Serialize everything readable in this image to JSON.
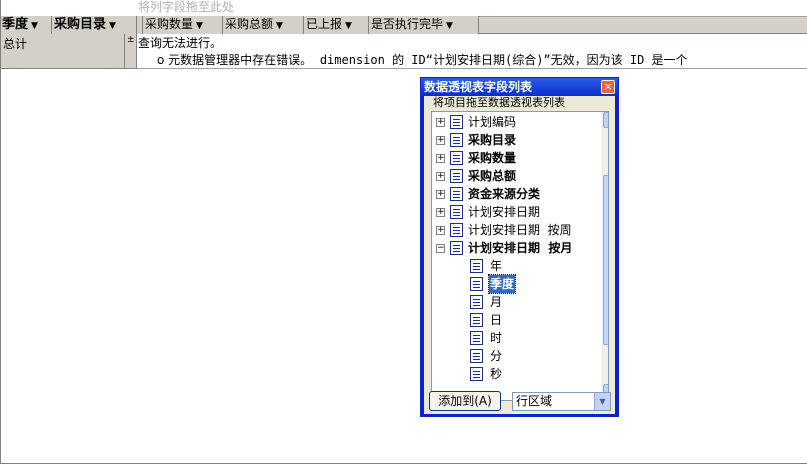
{
  "pivot": {
    "column_drop_hint": "将列字段拖至此处",
    "row_fields": [
      "季度",
      "采购目录"
    ],
    "data_fields": [
      "采购数量",
      "采购总额",
      "已上报",
      "是否执行完毕"
    ],
    "total_label": "总计",
    "expand_glyph": "±",
    "error_title": "查询无法进行。",
    "error_bullet": "o",
    "error_detail_prefix": "元数据管理器中存在错误。",
    "error_detail_rest": "dimension 的 ID“计划安排日期(综合)”无效，因为该 ID 是一个"
  },
  "field_list": {
    "title": "数据透视表字段列表",
    "close_glyph": "×",
    "hint": "将项目拖至数据透视表列表",
    "items": [
      {
        "label": "计划编码",
        "bold": false,
        "expander": "+"
      },
      {
        "label": "采购目录",
        "bold": true,
        "expander": "+"
      },
      {
        "label": "采购数量",
        "bold": true,
        "expander": "+"
      },
      {
        "label": "采购总额",
        "bold": true,
        "expander": "+"
      },
      {
        "label": "资金来源分类",
        "bold": true,
        "expander": "+"
      },
      {
        "label": "计划安排日期",
        "bold": false,
        "expander": "+"
      },
      {
        "label": "计划安排日期  按周",
        "bold": false,
        "expander": "+"
      },
      {
        "label": "计划安排日期  按月",
        "bold": true,
        "expander": "−"
      }
    ],
    "subitems": [
      {
        "label": "年",
        "selected": false
      },
      {
        "label": "季度",
        "selected": true
      },
      {
        "label": "月",
        "selected": false
      },
      {
        "label": "日",
        "selected": false
      },
      {
        "label": "时",
        "selected": false
      },
      {
        "label": "分",
        "selected": false
      },
      {
        "label": "秒",
        "selected": false
      }
    ],
    "scroll_up": "▲",
    "scroll_down": "▼",
    "add_button": "添加到(A)",
    "area_select": "行区域",
    "combo_arrow": "▼"
  },
  "colors": {
    "title_bar": "#0a24c8",
    "selection": "#316ac5",
    "face": "#d4d0c8"
  }
}
